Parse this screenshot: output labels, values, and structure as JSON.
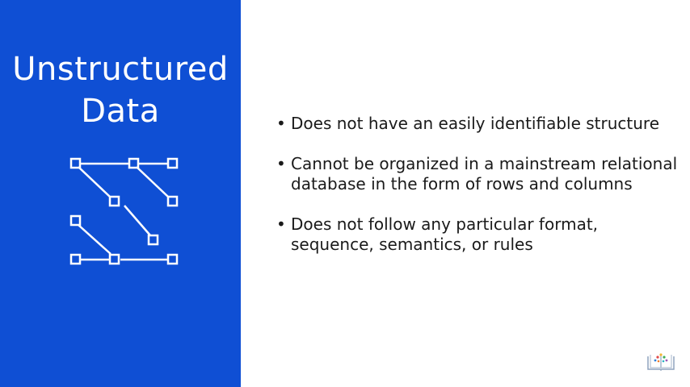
{
  "slide": {
    "title_line1": "Unstructured",
    "title_line2": "Data",
    "bullets": [
      "Does not have an easily identifiable structure",
      "Cannot be organized in a mainstream relational database in the form of rows and columns",
      "Does not follow any particular format, sequence, semantics, or rules"
    ]
  },
  "icons": {
    "diagram": "unstructured-data-icon",
    "logo": "open-book-logo-icon"
  },
  "colors": {
    "panel": "#0f4fd4",
    "panel_text": "#ffffff",
    "body_text": "#1a1a1a"
  }
}
